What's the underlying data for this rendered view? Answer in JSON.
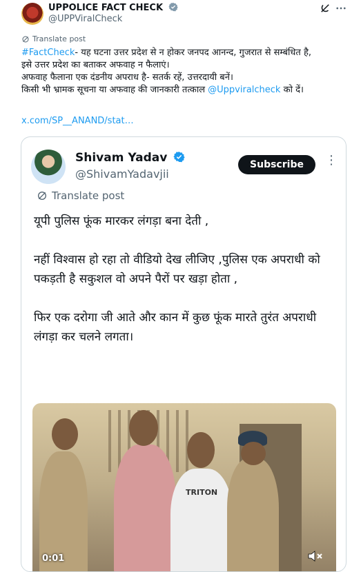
{
  "header": {
    "name": "UPPOLICE FACT CHECK",
    "handle": "@UPPViralCheck"
  },
  "translate_label": "Translate post",
  "body": {
    "hashtag": "#FactCheck",
    "line1_rest": "- यह घटना उत्तर प्रदेश से न होकर जनपद आनन्द, गुजरात से सम्बंधित है,",
    "line2": "इसे उत्तर प्रदेश का बताकर अफवाह न फैलाएं।",
    "line3": "अफवाह फैलाना एक दंडनीय अपराध है- सतर्क रहें, उत्तरदायी बनें।",
    "line4_pre": "किसी भी भ्रामक सूचना या अफवाह की जानकारी तत्काल ",
    "line4_mention": "@Uppviralcheck",
    "line4_post": " को दें।",
    "link": "x.com/SP__ANAND/stat…"
  },
  "quoted": {
    "name": "Shivam Yadav",
    "handle": "@ShivamYadavjii",
    "subscribe_label": "Subscribe",
    "translate_label": "Translate post",
    "para1": "यूपी पुलिस फूंक मारकर लंगड़ा बना देती ,",
    "para2": "नहीं विश्वास हो रहा तो वीडियो देख लीजिए ,पुलिस एक अपराधी को पकड़ती है सकुशल वो अपने पैरों पर खड़ा होता ,",
    "para3": "फिर एक दरोगा जी आते और कान में कुछ फूंक मारते तुरंत अपराधी लंगड़ा कर चलने लगता।",
    "video_time": "0:01",
    "video_tshirt_text": "TRITON"
  },
  "icons": {
    "verified": "verified-badge-icon",
    "grok": "grok-icon",
    "more": "more-icon",
    "translate": "translate-icon",
    "mute": "mute-icon"
  },
  "colors": {
    "accent": "#1d9bf0",
    "text": "#0f1419",
    "secondary": "#536471"
  }
}
